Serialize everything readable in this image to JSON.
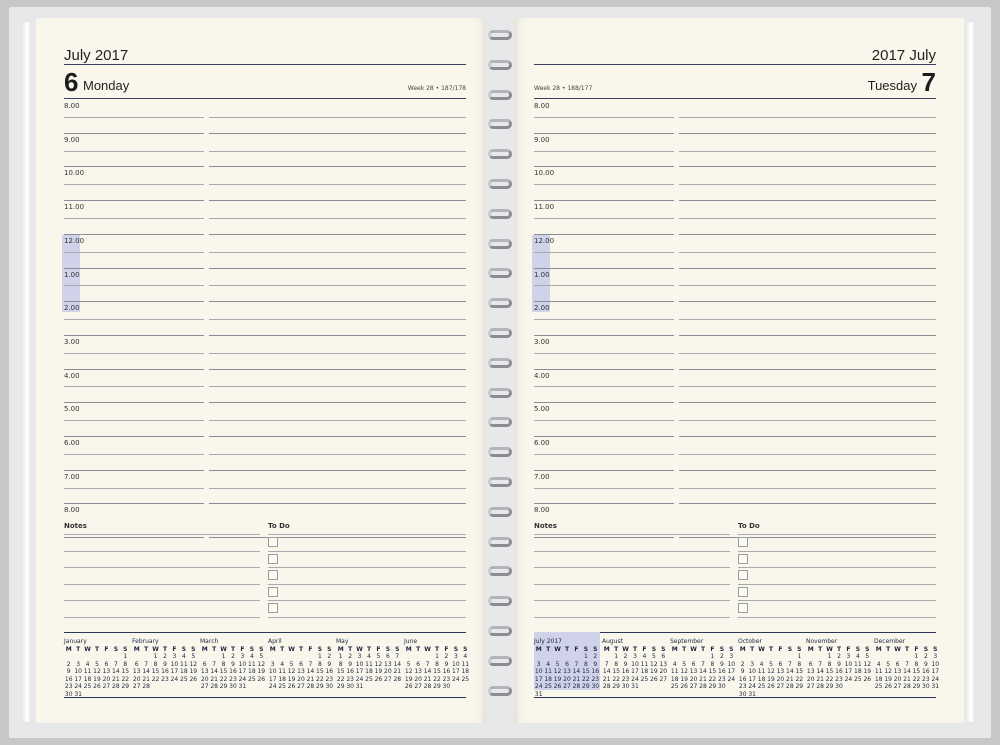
{
  "left": {
    "month": "July 2017",
    "day_num": "6",
    "day_name": "Monday",
    "week": "Week 28 • 187/178"
  },
  "right": {
    "month": "2017 July",
    "day_num": "7",
    "day_name": "Tuesday",
    "week": "Week 28 • 188/177"
  },
  "hours": [
    "8.00",
    "9.00",
    "10.00",
    "11.00",
    "12.00",
    "1.00",
    "2.00",
    "3.00",
    "4.00",
    "5.00",
    "6.00",
    "7.00",
    "8.00"
  ],
  "notes_label": "Notes",
  "todo_label": "To Do",
  "weekdays": [
    "M",
    "T",
    "W",
    "T",
    "F",
    "S",
    "S"
  ],
  "calendar_left": [
    {
      "name": "January",
      "offset": 6,
      "days": 31
    },
    {
      "name": "February",
      "offset": 2,
      "days": 28
    },
    {
      "name": "March",
      "offset": 2,
      "days": 31
    },
    {
      "name": "April",
      "offset": 5,
      "days": 30
    },
    {
      "name": "May",
      "offset": 0,
      "days": 31
    },
    {
      "name": "June",
      "offset": 3,
      "days": 30
    }
  ],
  "calendar_right": [
    {
      "name": "July 2017",
      "offset": 5,
      "days": 31,
      "active": true
    },
    {
      "name": "August",
      "offset": 1,
      "days": 31
    },
    {
      "name": "September",
      "offset": 4,
      "days": 30
    },
    {
      "name": "October",
      "offset": 6,
      "days": 31
    },
    {
      "name": "November",
      "offset": 2,
      "days": 30
    },
    {
      "name": "December",
      "offset": 4,
      "days": 31
    }
  ],
  "colors": {
    "paper": "#f9f7ec",
    "accent_highlight": "#cfd2e8",
    "rule": "#3a3f5c"
  }
}
